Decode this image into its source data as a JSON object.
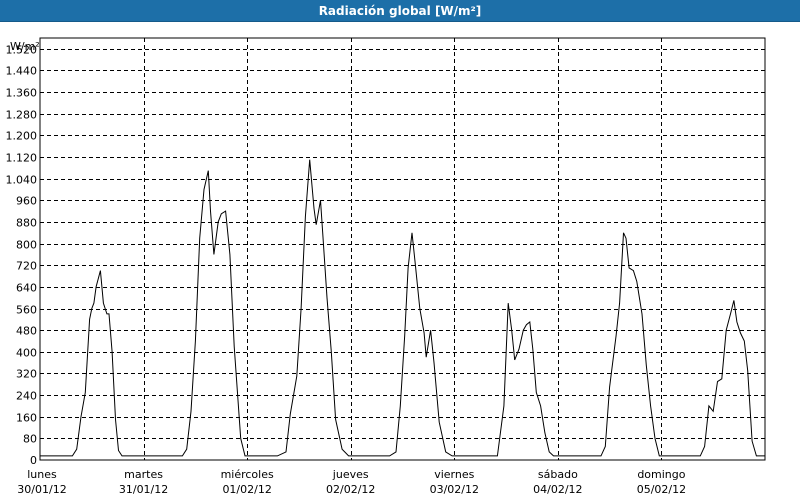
{
  "window": {
    "title": "Radiación global [W/m²]"
  },
  "chart_data": {
    "type": "line",
    "title": "Radiación global [W/m²]",
    "ylabel": "W/m²",
    "xlabel": "",
    "ylim": [
      0,
      1560
    ],
    "yticks": [
      80,
      160,
      240,
      320,
      400,
      480,
      560,
      640,
      720,
      800,
      880,
      960,
      1040,
      1120,
      1200,
      1280,
      1360,
      1440,
      1520
    ],
    "ytick_labels": [
      "80",
      "160",
      "240",
      "320",
      "400",
      "480",
      "560",
      "640",
      "720",
      "800",
      "880",
      "960",
      "1.040",
      "1.120",
      "1.200",
      "1.280",
      "1.360",
      "1.440",
      "1.520"
    ],
    "y_zero_label": "0",
    "x_range_hours": [
      0,
      168
    ],
    "days": [
      {
        "name": "lunes",
        "date": "30/01/12"
      },
      {
        "name": "martes",
        "date": "31/01/12"
      },
      {
        "name": "miércoles",
        "date": "01/02/12"
      },
      {
        "name": "jueves",
        "date": "02/02/12"
      },
      {
        "name": "viernes",
        "date": "03/02/12"
      },
      {
        "name": "sábado",
        "date": "04/02/12"
      },
      {
        "name": "domingo",
        "date": "05/02/12"
      }
    ],
    "grid": true,
    "series": [
      {
        "color": "#000000",
        "points": [
          [
            0,
            15
          ],
          [
            7.5,
            15
          ],
          [
            8.5,
            40
          ],
          [
            9.5,
            160
          ],
          [
            10.5,
            250
          ],
          [
            11.5,
            520
          ],
          [
            12,
            560
          ],
          [
            12.5,
            580
          ],
          [
            13,
            640
          ],
          [
            14,
            700
          ],
          [
            14.7,
            580
          ],
          [
            15.5,
            540
          ],
          [
            16,
            540
          ],
          [
            16.7,
            400
          ],
          [
            17.5,
            150
          ],
          [
            18.2,
            35
          ],
          [
            19,
            15
          ],
          [
            24,
            15
          ],
          [
            33,
            15
          ],
          [
            34,
            40
          ],
          [
            35,
            180
          ],
          [
            36,
            440
          ],
          [
            37,
            820
          ],
          [
            38,
            1000
          ],
          [
            39,
            1070
          ],
          [
            39.5,
            920
          ],
          [
            40.3,
            760
          ],
          [
            41.3,
            880
          ],
          [
            42,
            910
          ],
          [
            43,
            920
          ],
          [
            44,
            760
          ],
          [
            45,
            420
          ],
          [
            46.5,
            80
          ],
          [
            47.5,
            15
          ],
          [
            48,
            15
          ],
          [
            55,
            15
          ],
          [
            57,
            30
          ],
          [
            58,
            170
          ],
          [
            59.5,
            310
          ],
          [
            60.5,
            560
          ],
          [
            61.5,
            900
          ],
          [
            62.5,
            1110
          ],
          [
            63.5,
            930
          ],
          [
            64,
            870
          ],
          [
            65,
            960
          ],
          [
            65.5,
            840
          ],
          [
            66.5,
            600
          ],
          [
            67.5,
            400
          ],
          [
            68.5,
            150
          ],
          [
            70,
            40
          ],
          [
            71.5,
            15
          ],
          [
            72,
            15
          ],
          [
            81,
            15
          ],
          [
            82.5,
            30
          ],
          [
            83.5,
            200
          ],
          [
            84.5,
            460
          ],
          [
            85.3,
            710
          ],
          [
            86.2,
            840
          ],
          [
            87,
            720
          ],
          [
            88,
            560
          ],
          [
            89,
            470
          ],
          [
            89.5,
            380
          ],
          [
            90.5,
            480
          ],
          [
            91.3,
            360
          ],
          [
            92.5,
            140
          ],
          [
            94,
            30
          ],
          [
            95.5,
            15
          ],
          [
            96,
            15
          ],
          [
            106,
            15
          ],
          [
            107.5,
            200
          ],
          [
            108.5,
            580
          ],
          [
            109.3,
            480
          ],
          [
            110,
            370
          ],
          [
            111,
            410
          ],
          [
            112,
            480
          ],
          [
            112.7,
            500
          ],
          [
            113.5,
            510
          ],
          [
            114.2,
            410
          ],
          [
            115,
            250
          ],
          [
            116,
            200
          ],
          [
            117,
            100
          ],
          [
            118,
            30
          ],
          [
            119,
            15
          ],
          [
            120,
            15
          ],
          [
            130,
            15
          ],
          [
            131,
            50
          ],
          [
            132,
            270
          ],
          [
            133.5,
            460
          ],
          [
            134.3,
            580
          ],
          [
            135.2,
            840
          ],
          [
            135.8,
            820
          ],
          [
            136.5,
            710
          ],
          [
            137.5,
            700
          ],
          [
            138.3,
            660
          ],
          [
            139.5,
            540
          ],
          [
            140.5,
            350
          ],
          [
            141.5,
            200
          ],
          [
            142.5,
            80
          ],
          [
            143.5,
            15
          ],
          [
            144,
            15
          ],
          [
            153,
            15
          ],
          [
            154,
            50
          ],
          [
            155,
            200
          ],
          [
            156,
            180
          ],
          [
            157,
            290
          ],
          [
            158,
            300
          ],
          [
            159,
            480
          ],
          [
            160,
            540
          ],
          [
            160.8,
            590
          ],
          [
            161.5,
            510
          ],
          [
            162.3,
            470
          ],
          [
            163.2,
            440
          ],
          [
            164,
            330
          ],
          [
            165,
            70
          ],
          [
            166,
            15
          ],
          [
            168,
            15
          ]
        ]
      }
    ]
  }
}
